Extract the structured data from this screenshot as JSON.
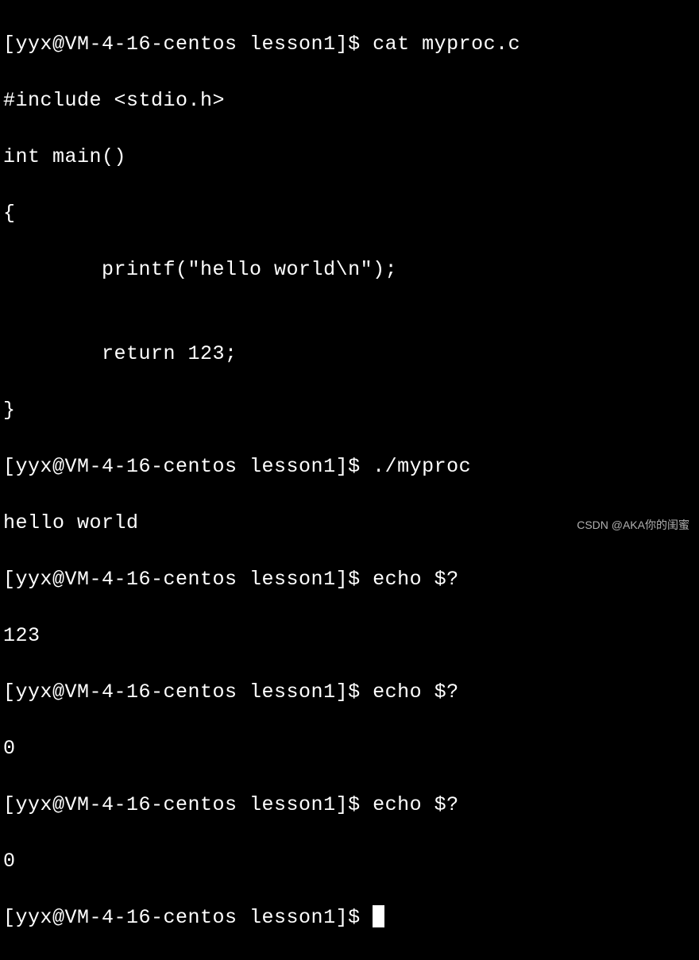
{
  "prompt": "[yyx@VM-4-16-centos lesson1]$ ",
  "commands": {
    "cat": "cat myproc.c",
    "run": "./myproc",
    "echo1": "echo $?",
    "echo2": "echo $?",
    "echo3": "echo $?",
    "empty": ""
  },
  "source": {
    "l1": "#include <stdio.h>",
    "l2": "int main()",
    "l3": "{",
    "l4": "        printf(\"hello world\\n\");",
    "l5": "",
    "l6": "        return 123;",
    "l7": "}"
  },
  "output": {
    "hello": "hello world",
    "exit1": "123",
    "exit2": "0",
    "exit3": "0"
  },
  "watermark": "CSDN @AKA你的闺蜜"
}
